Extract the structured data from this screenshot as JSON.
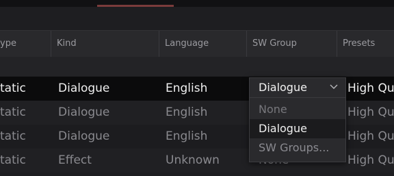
{
  "header": {
    "columns": [
      "ype",
      "Kind",
      "Language",
      "SW Group",
      "Presets"
    ]
  },
  "rows": [
    {
      "type": "tatic",
      "kind": "Dialogue",
      "language": "English",
      "sw_group": "Dialogue",
      "presets": "High Qua"
    },
    {
      "type": "tatic",
      "kind": "Dialogue",
      "language": "English",
      "sw_group": "",
      "presets": "High Qua"
    },
    {
      "type": "tatic",
      "kind": "Dialogue",
      "language": "English",
      "sw_group": "",
      "presets": "High Qua"
    },
    {
      "type": "tatic",
      "kind": "Effect",
      "language": "Unknown",
      "sw_group": "None",
      "presets": "High Qua"
    }
  ],
  "dropdown": {
    "selected": "Dialogue",
    "options": [
      "None",
      "Dialogue",
      "SW Groups..."
    ],
    "chevron_icon": "chevron-down-icon"
  },
  "colors": {
    "background": "#1e1e21",
    "header": "#29292c",
    "selected_row": "#0b0b0c",
    "top_accent": "#7a3b3b"
  }
}
